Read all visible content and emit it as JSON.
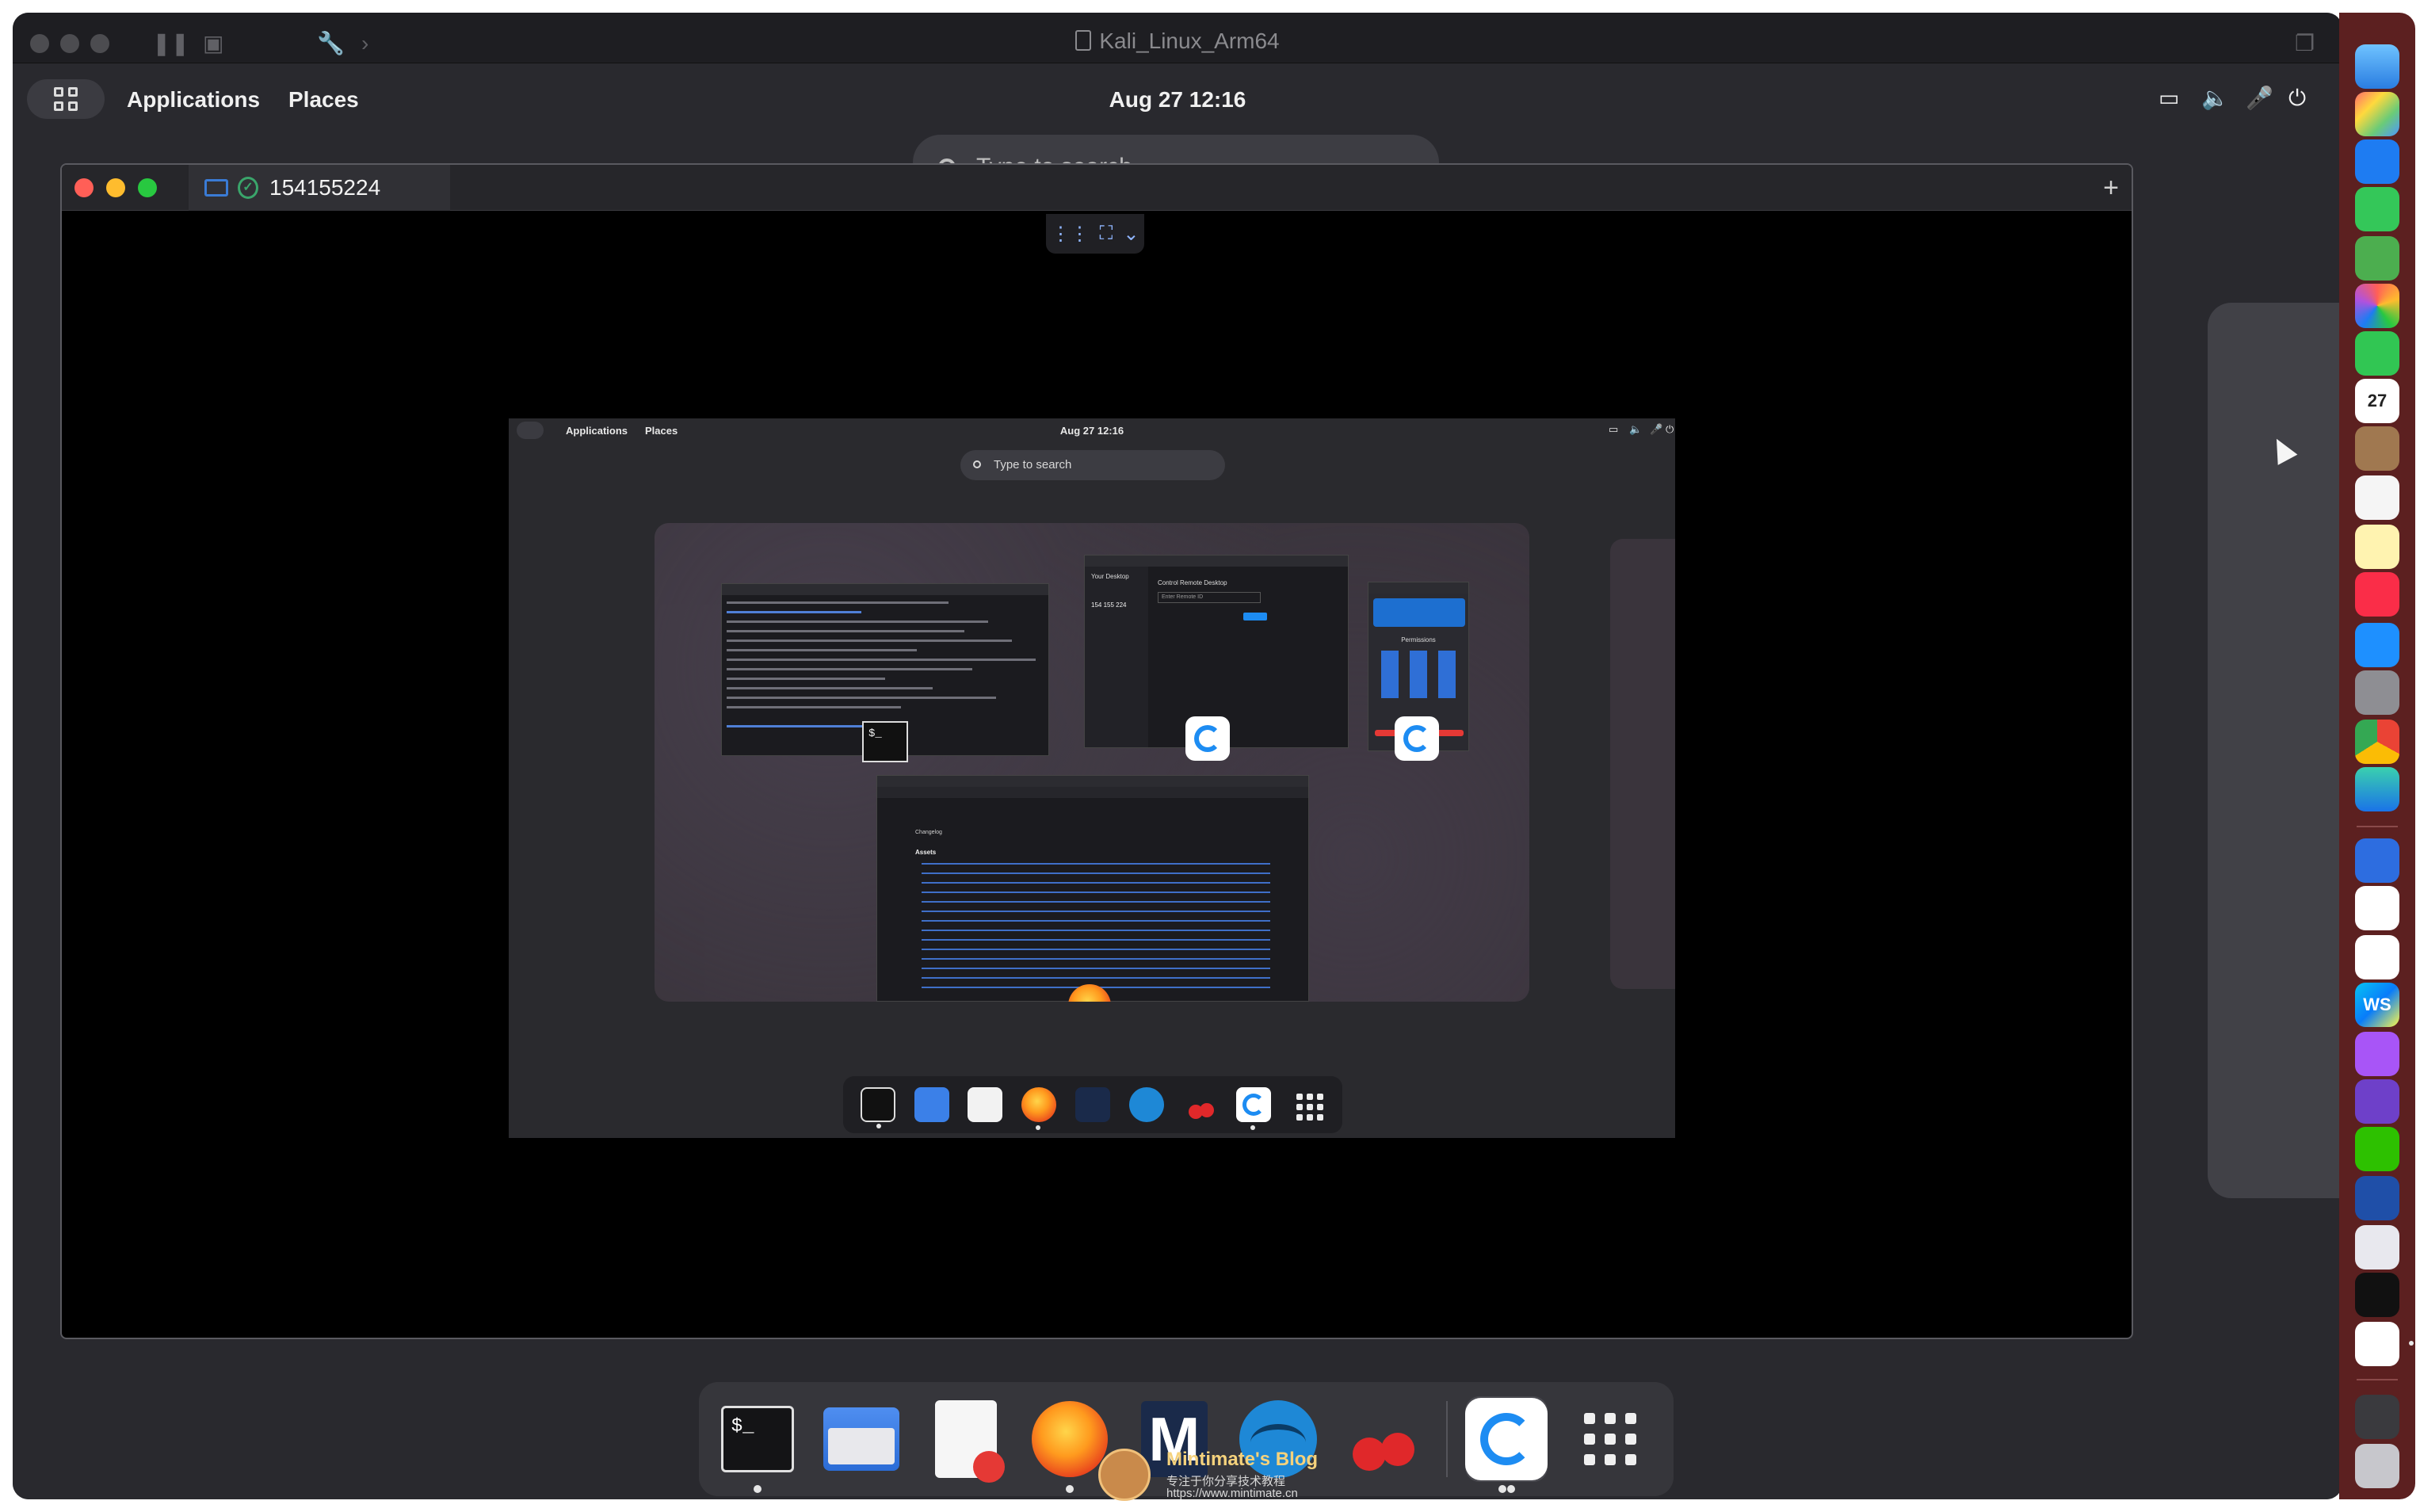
{
  "vm_window": {
    "title": "Kali_Linux_Arm64"
  },
  "kali": {
    "menu_applications": "Applications",
    "menu_places": "Places",
    "clock": "Aug 27  12:16",
    "search_placeholder": "Type to search"
  },
  "remote_desktop": {
    "tab_label": "154155224",
    "add_tab": "+"
  },
  "remote_screen": {
    "menu_applications": "Applications",
    "menu_places": "Places",
    "clock": "Aug 27  12:16",
    "search_placeholder": "Type to search",
    "thumbnails": {
      "rustdesk": {
        "your_desktop": "Your Desktop",
        "id_value": "154 155 224",
        "control_title": "Control Remote Desktop",
        "remote_id_placeholder": "Enter Remote ID"
      },
      "permissions_window": {
        "title": "Permissions"
      },
      "browser": {
        "section_changelog": "Changelog",
        "section_assets": "Assets"
      }
    }
  },
  "watermark": {
    "title": "Mintimate's Blog",
    "subtitle": "专注于你分享技术教程",
    "url": "https://www.mintimate.cn"
  },
  "mac_dock": {
    "calendar_day": "27",
    "webstorm_label": "WS"
  },
  "icons": {
    "terminal": "terminal-icon",
    "files": "folder-icon",
    "text_editor": "text-editor-icon",
    "firefox": "firefox-icon",
    "maltego": "maltego-icon",
    "wireshark": "wireshark-icon",
    "cherrytree": "cherry-icon",
    "rustdesk": "rustdesk-icon",
    "app_grid": "app-grid-icon"
  },
  "colors": {
    "kali_bg": "#29292e",
    "accent_blue": "#1d8cf2",
    "mac_dock_bg": "#5c2020",
    "traffic_red": "#ff5f57",
    "traffic_yellow": "#febc2e",
    "traffic_green": "#28c840"
  }
}
